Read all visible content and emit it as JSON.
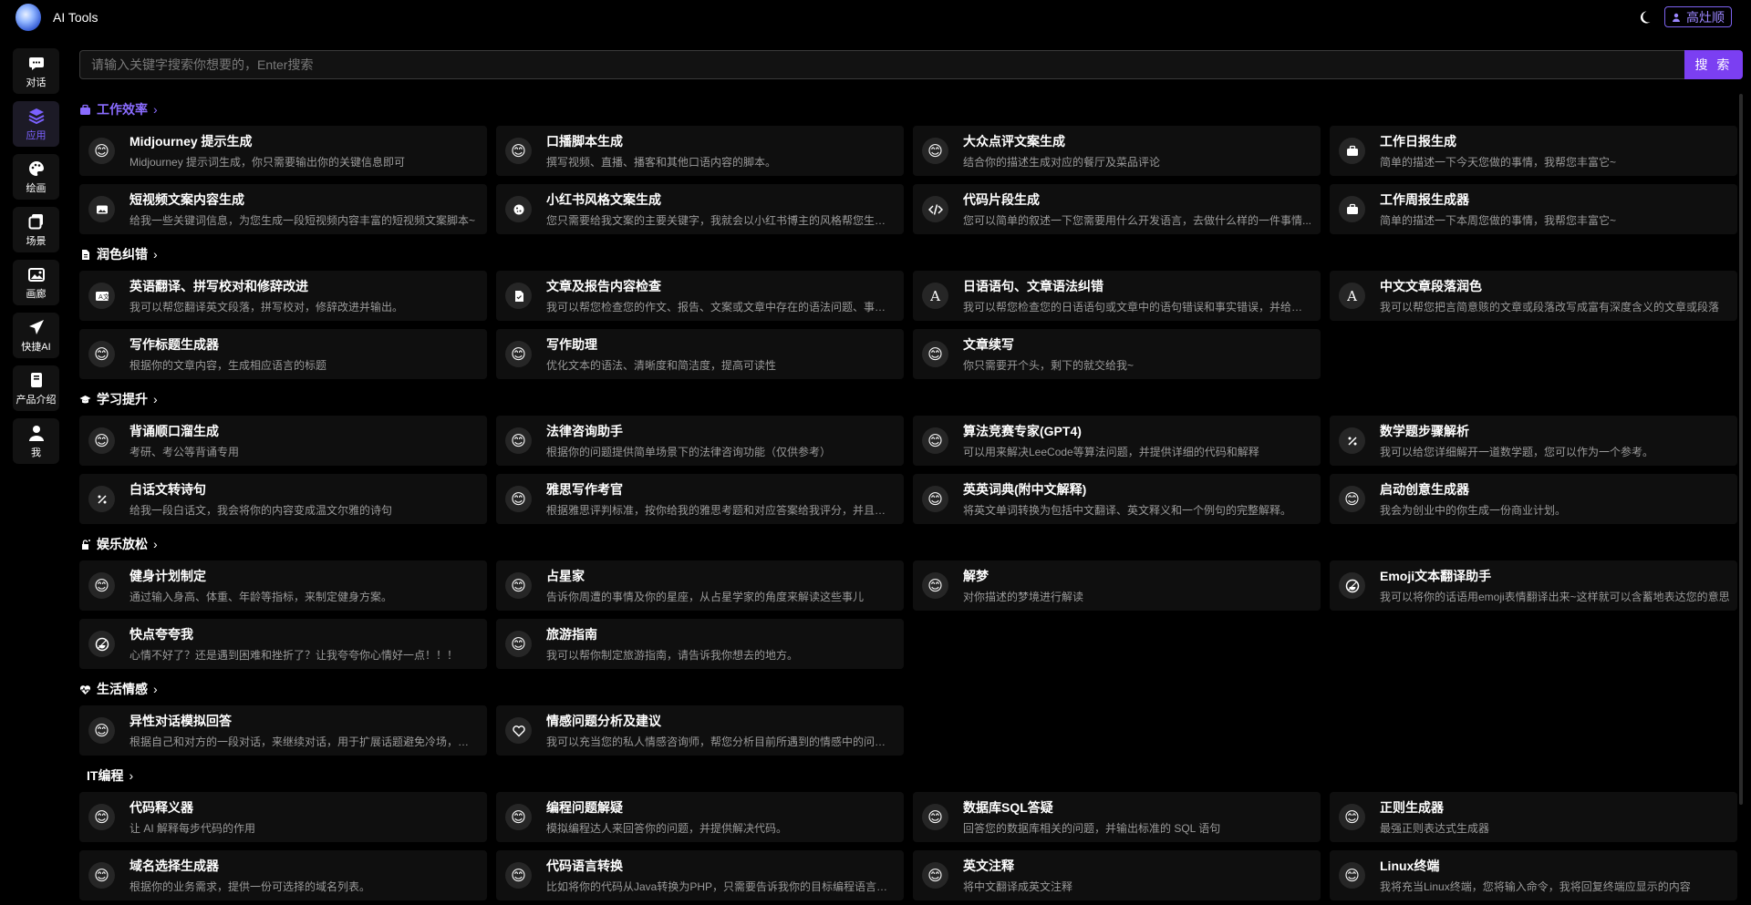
{
  "app": {
    "title": "AI Tools"
  },
  "header": {
    "user_label": "高灶顺"
  },
  "sidebar": {
    "items": [
      {
        "label": "对话",
        "icon": "chat-icon"
      },
      {
        "label": "应用",
        "icon": "layers-icon",
        "active": true
      },
      {
        "label": "绘画",
        "icon": "palette-icon"
      },
      {
        "label": "场景",
        "icon": "stack-icon"
      },
      {
        "label": "画廊",
        "icon": "gallery-icon"
      },
      {
        "label": "快捷AI",
        "icon": "send-icon"
      },
      {
        "label": "产品介绍",
        "icon": "book-icon"
      },
      {
        "label": "我",
        "icon": "user-icon"
      }
    ]
  },
  "search": {
    "placeholder": "请输入关键字搜索你想要的，Enter搜索",
    "button_label": "搜 索"
  },
  "accent_color": "#7b3ff2",
  "sections": [
    {
      "title": "工作效率",
      "icon": "briefcase-icon",
      "cards": [
        {
          "title": "Midjourney 提示生成",
          "desc": "Midjourney 提示词生成，你只需要输出你的关键信息即可",
          "icon": "smile-emoji"
        },
        {
          "title": "口播脚本生成",
          "desc": "撰写视频、直播、播客和其他口语内容的脚本。",
          "icon": "smile-emoji"
        },
        {
          "title": "大众点评文案生成",
          "desc": "结合你的描述生成对应的餐厅及菜品评论",
          "icon": "smile-emoji"
        },
        {
          "title": "工作日报生成",
          "desc": "简单的描述一下今天您做的事情，我帮您丰富它~",
          "icon": "briefcase-icon"
        },
        {
          "title": "短视频文案内容生成",
          "desc": "给我一些关键词信息，为您生成一段短视频内容丰富的短视频文案脚本~",
          "icon": "photo-icon"
        },
        {
          "title": "小红书风格文案生成",
          "desc": "您只需要给我文案的主要关键字，我就会以小红书博主的风格帮您生成文案~",
          "icon": "cookie-icon"
        },
        {
          "title": "代码片段生成",
          "desc": "您可以简单的叙述一下您需要用什么开发语言，去做什么样的一件事情...",
          "icon": "code-icon"
        },
        {
          "title": "工作周报生成器",
          "desc": "简单的描述一下本周您做的事情，我帮您丰富它~",
          "icon": "briefcase-icon"
        }
      ]
    },
    {
      "title": "润色纠错",
      "icon": "document-icon",
      "cards": [
        {
          "title": "英语翻译、拼写校对和修辞改进",
          "desc": "我可以帮您翻译英文段落，拼写校对，修辞改进并输出。",
          "icon": "translate-icon"
        },
        {
          "title": "文章及报告内容检查",
          "desc": "我可以帮您检查您的作文、报告、文案或文章中存在的语法问题、事实错误等",
          "icon": "file-check-icon"
        },
        {
          "title": "日语语句、文章语法纠错",
          "desc": "我可以帮您检查您的日语语句或文章中的语句错误和事实错误，并给您修改建议",
          "icon": "letter-a-icon"
        },
        {
          "title": "中文文章段落润色",
          "desc": "我可以帮您把言简意赅的文章或段落改写成富有深度含义的文章或段落",
          "icon": "letter-a-icon"
        },
        {
          "title": "写作标题生成器",
          "desc": "根据你的文章内容，生成相应语言的标题",
          "icon": "smile-emoji"
        },
        {
          "title": "写作助理",
          "desc": "优化文本的语法、清晰度和简洁度，提高可读性",
          "icon": "smile-emoji"
        },
        {
          "title": "文章续写",
          "desc": "你只需要开个头，剩下的就交给我~",
          "icon": "smile-emoji"
        }
      ]
    },
    {
      "title": "学习提升",
      "icon": "graduation-icon",
      "cards": [
        {
          "title": "背诵顺口溜生成",
          "desc": "考研、考公等背诵专用",
          "icon": "smile-emoji"
        },
        {
          "title": "法律咨询助手",
          "desc": "根据你的问题提供简单场景下的法律咨询功能（仅供参考）",
          "icon": "smile-emoji"
        },
        {
          "title": "算法竞赛专家(GPT4)",
          "desc": "可以用来解决LeeCode等算法问题，并提供详细的代码和解释",
          "icon": "smile-emoji"
        },
        {
          "title": "数学题步骤解析",
          "desc": "我可以给您详细解开一道数学题，您可以作为一个参考。",
          "icon": "percent-icon"
        },
        {
          "title": "白话文转诗句",
          "desc": "给我一段白话文，我会将你的内容变成温文尔雅的诗句",
          "icon": "percent-icon"
        },
        {
          "title": "雅思写作考官",
          "desc": "根据雅思评判标准，按你给我的雅思考题和对应答案给我评分，并且按照雅思写作标准给出修改建议",
          "icon": "smile-emoji"
        },
        {
          "title": "英英词典(附中文解释)",
          "desc": "将英文单词转换为包括中文翻译、英文释义和一个例句的完整解释。",
          "icon": "smile-emoji"
        },
        {
          "title": "启动创意生成器",
          "desc": "我会为创业中的你生成一份商业计划。",
          "icon": "smile-emoji"
        }
      ]
    },
    {
      "title": "娱乐放松",
      "icon": "fun-icon",
      "cards": [
        {
          "title": "健身计划制定",
          "desc": "通过输入身高、体重、年龄等指标，来制定健身方案。",
          "icon": "smile-emoji"
        },
        {
          "title": "占星家",
          "desc": "告诉你周遭的事情及你的星座，从占星学家的角度来解读这些事儿",
          "icon": "smile-emoji"
        },
        {
          "title": "解梦",
          "desc": "对你描述的梦境进行解读",
          "icon": "smile-emoji"
        },
        {
          "title": "Emoji文本翻译助手",
          "desc": "我可以将你的话语用emoji表情翻译出来~这样就可以含蓄地表达您的意思",
          "icon": "happy-icon"
        },
        {
          "title": "快点夸夸我",
          "desc": "心情不好了？还是遇到困难和挫折了？让我夸夸你心情好一点！！！",
          "icon": "happy-icon"
        },
        {
          "title": "旅游指南",
          "desc": "我可以帮你制定旅游指南，请告诉我你想去的地方。",
          "icon": "smile-emoji"
        }
      ]
    },
    {
      "title": "生活情感",
      "icon": "heart-pulse-icon",
      "cards": [
        {
          "title": "异性对话模拟回答",
          "desc": "根据自己和对方的一段对话，来继续对话，用于扩展话题避免冷场，该功能仅供娱乐",
          "icon": "smile-emoji"
        },
        {
          "title": "情感问题分析及建议",
          "desc": "我可以充当您的私人情感咨询师，帮您分析目前所遇到的情感中的问题并给出建议",
          "icon": "heart-icon"
        }
      ]
    },
    {
      "title": "IT编程",
      "icon": "",
      "cards": [
        {
          "title": "代码释义器",
          "desc": "让 AI 解释每步代码的作用",
          "icon": "smile-emoji"
        },
        {
          "title": "编程问题解疑",
          "desc": "模拟编程达人来回答你的问题，并提供解决代码。",
          "icon": "smile-emoji"
        },
        {
          "title": "数据库SQL答疑",
          "desc": "回答您的数据库相关的问题，并输出标准的 SQL 语句",
          "icon": "smile-emoji"
        },
        {
          "title": "正则生成器",
          "desc": "最强正则表达式生成器",
          "icon": "smile-emoji"
        },
        {
          "title": "域名选择生成器",
          "desc": "根据你的业务需求，提供一份可选择的域名列表。",
          "icon": "smile-emoji"
        },
        {
          "title": "代码语言转换",
          "desc": "比如将你的代码从Java转换为PHP，只需要告诉我你的目标编程语言和代码",
          "icon": "smile-emoji"
        },
        {
          "title": "英文注释",
          "desc": "将中文翻译成英文注释",
          "icon": "smile-emoji"
        },
        {
          "title": "Linux终端",
          "desc": "我将充当Linux终端，您将输入命令，我将回复终端应显示的内容",
          "icon": "smile-emoji"
        }
      ]
    }
  ]
}
